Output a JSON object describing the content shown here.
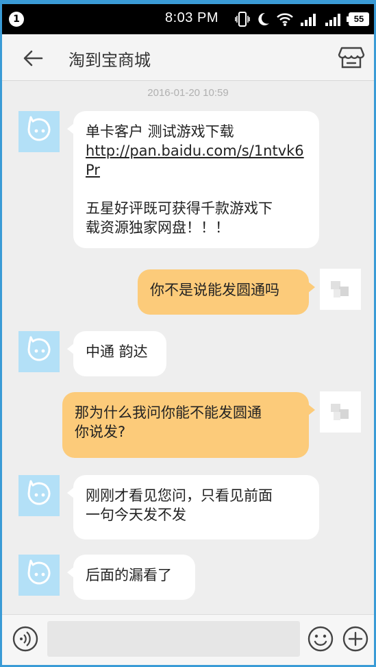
{
  "status_bar": {
    "notification_count": "1",
    "time": "8:03 PM",
    "battery": "55"
  },
  "header": {
    "title": "淘到宝商城",
    "back_icon": "arrow-left-icon",
    "shop_icon": "storefront-icon"
  },
  "chat": {
    "timestamp": "2016-01-20 10:59",
    "messages": [
      {
        "sender": "shop",
        "lines": [
          "单卡客户 测试游戏下载",
          "http://pan.baidu.com/s/1ntvk6",
          "Pr",
          "",
          "五星好评既可获得千款游戏下",
          "载资源独家网盘！！！"
        ]
      },
      {
        "sender": "me",
        "lines": [
          "你不是说能发圆通吗"
        ]
      },
      {
        "sender": "shop",
        "lines": [
          "中通 韵达"
        ]
      },
      {
        "sender": "me",
        "lines": [
          "那为什么我问你能不能发圆通",
          "你说发?"
        ]
      },
      {
        "sender": "shop",
        "lines": [
          "刚刚才看见您问，只看见前面",
          "一句今天发不发"
        ]
      },
      {
        "sender": "shop",
        "lines": [
          "后面的漏看了"
        ]
      }
    ]
  },
  "input_bar": {
    "voice_icon": "voice-icon",
    "text_value": "",
    "emoji_icon": "emoji-icon",
    "plus_icon": "plus-icon"
  },
  "colors": {
    "incoming_bubble": "#ffffff",
    "outgoing_bubble": "#fccb7a",
    "bot_avatar_bg": "#b3e0f7",
    "frame_accent": "#3a9bd6"
  }
}
